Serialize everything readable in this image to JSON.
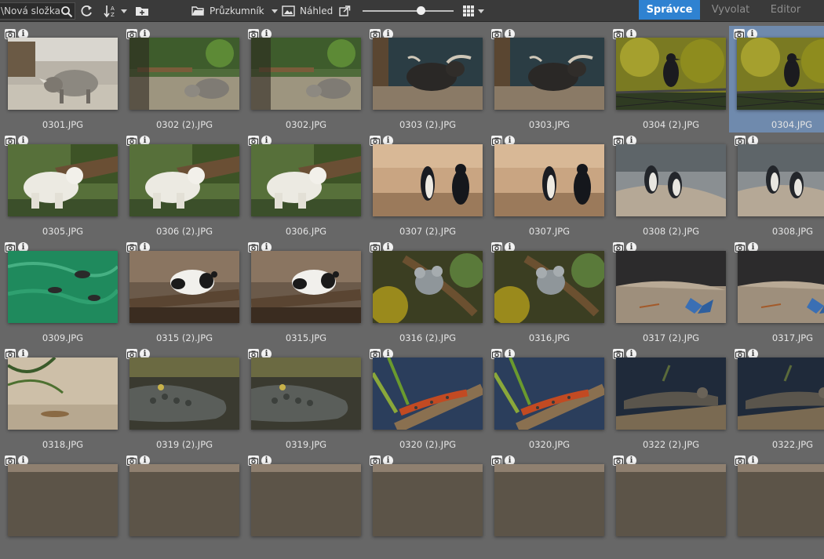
{
  "toolbar": {
    "path_text": "\\Nová složka",
    "explorer_label": "Průzkumník",
    "preview_label": "Náhled"
  },
  "modes": [
    {
      "label": "Správce",
      "active": true
    },
    {
      "label": "Vyvolat",
      "active": false
    },
    {
      "label": "Editor",
      "active": false
    }
  ],
  "thumbnail_size_fraction": 0.63,
  "files": [
    {
      "name": "0301.JPG",
      "subject": "rhino-single",
      "selected": false
    },
    {
      "name": "0302 (2).JPG",
      "subject": "rhino-group",
      "selected": false
    },
    {
      "name": "0302.JPG",
      "subject": "rhino-group",
      "selected": false
    },
    {
      "name": "0303 (2).JPG",
      "subject": "buffalo",
      "selected": false
    },
    {
      "name": "0303.JPG",
      "subject": "buffalo",
      "selected": false
    },
    {
      "name": "0304 (2).JPG",
      "subject": "crow",
      "selected": false
    },
    {
      "name": "0304.JPG",
      "subject": "crow",
      "selected": true
    },
    {
      "name": "0305.JPG",
      "subject": "polar-bear",
      "selected": false
    },
    {
      "name": "0306 (2).JPG",
      "subject": "polar-bear",
      "selected": false
    },
    {
      "name": "0306.JPG",
      "subject": "polar-bear",
      "selected": false
    },
    {
      "name": "0307 (2).JPG",
      "subject": "penguins-indoor",
      "selected": false
    },
    {
      "name": "0307.JPG",
      "subject": "penguins-indoor",
      "selected": false
    },
    {
      "name": "0308 (2).JPG",
      "subject": "penguins-rocks",
      "selected": false
    },
    {
      "name": "0308.JPG",
      "subject": "penguins-rocks",
      "selected": false
    },
    {
      "name": "0309.JPG",
      "subject": "penguins-water",
      "selected": false
    },
    {
      "name": "0315 (2).JPG",
      "subject": "panda",
      "selected": false
    },
    {
      "name": "0315.JPG",
      "subject": "panda",
      "selected": false
    },
    {
      "name": "0316 (2).JPG",
      "subject": "koala",
      "selected": false
    },
    {
      "name": "0316.JPG",
      "subject": "koala",
      "selected": false
    },
    {
      "name": "0317 (2).JPG",
      "subject": "butterfly",
      "selected": false
    },
    {
      "name": "0317.JPG",
      "subject": "butterfly",
      "selected": false
    },
    {
      "name": "0318.JPG",
      "subject": "lizard-sand",
      "selected": false
    },
    {
      "name": "0319 (2).JPG",
      "subject": "crocodile",
      "selected": false
    },
    {
      "name": "0319.JPG",
      "subject": "crocodile",
      "selected": false
    },
    {
      "name": "0320 (2).JPG",
      "subject": "lizard-branch",
      "selected": false
    },
    {
      "name": "0320.JPG",
      "subject": "lizard-branch",
      "selected": false
    },
    {
      "name": "0322 (2).JPG",
      "subject": "iguana",
      "selected": false
    },
    {
      "name": "0322.JPG",
      "subject": "iguana",
      "selected": false
    },
    {
      "name": "",
      "subject": "partial",
      "selected": false
    },
    {
      "name": "",
      "subject": "partial",
      "selected": false
    },
    {
      "name": "",
      "subject": "partial",
      "selected": false
    },
    {
      "name": "",
      "subject": "partial",
      "selected": false
    },
    {
      "name": "",
      "subject": "partial",
      "selected": false
    },
    {
      "name": "",
      "subject": "partial",
      "selected": false
    },
    {
      "name": "",
      "subject": "partial",
      "selected": false
    }
  ],
  "colors": {
    "accent": "#2f82d1",
    "selection": "#6f8aad",
    "background": "#676767",
    "toolbar": "#3a3a3a"
  }
}
